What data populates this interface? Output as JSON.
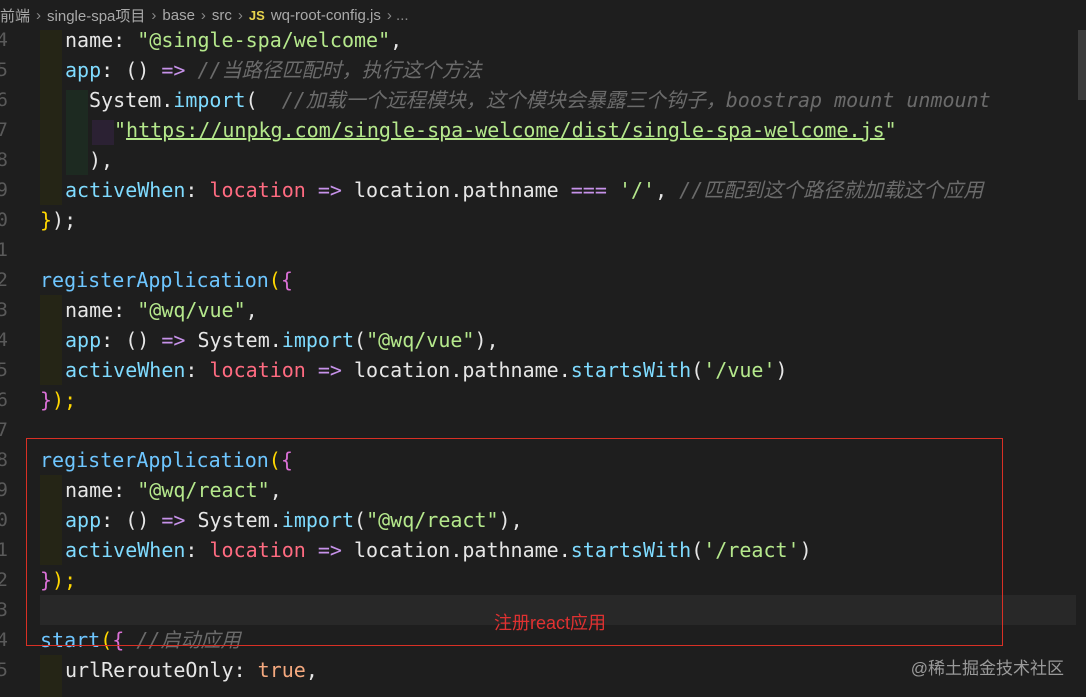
{
  "breadcrumb": {
    "items": [
      "前端",
      "single-spa项目",
      "base",
      "src"
    ],
    "separator": "›",
    "file_badge": "JS",
    "file": "wq-root-config.js",
    "trailing": "› ..."
  },
  "editor": {
    "line_numbers": [
      "4",
      "5",
      "6",
      "7",
      "8",
      "9",
      "0",
      "1",
      "2",
      "3",
      "4",
      "5",
      "6",
      "7",
      "8",
      "9",
      "0",
      "1",
      "2",
      "3",
      "4",
      "5"
    ],
    "lines": {
      "l1": {
        "k": "name",
        "colon": ": ",
        "v": "\"@single-spa/welcome\"",
        "end": ","
      },
      "l2": {
        "k": "app",
        "colon": ": ",
        "a": "() ",
        "arrow": "=>",
        "sp": " ",
        "c": "//当路径匹配时，执行这个方法"
      },
      "l3": {
        "obj": "System",
        "dot": ".",
        "fn": "import",
        "p": "(",
        "sp": "  ",
        "c": "//加载一个远程模块，这个模块会暴露三个钩子，boostrap mount unmount"
      },
      "l4": {
        "q1": "\"",
        "url": "https://unpkg.com/single-spa-welcome/dist/single-spa-welcome.js",
        "q2": "\""
      },
      "l5": {
        "t": "),"
      },
      "l6": {
        "k": "activeWhen",
        "colon": ": ",
        "param": "location",
        "arrow": " => ",
        "obj": "location.pathname",
        "eq": " === ",
        "v": "'/'",
        "sp": ", ",
        "c": "//匹配到这个路径就加载这个应用"
      },
      "l7": {
        "b": "}",
        "t": ");"
      },
      "l9": {
        "fn": "registerApplication",
        "p": "(",
        "b": "{"
      },
      "l10": {
        "k": "name",
        "colon": ": ",
        "v": "\"@wq/vue\"",
        "end": ","
      },
      "l11": {
        "k": "app",
        "colon": ": ",
        "a": "() ",
        "arrow": "=>",
        "sp": " ",
        "obj": "System",
        "dot": ".",
        "fn": "import",
        "p": "(",
        "v": "\"@wq/vue\"",
        "end": "),"
      },
      "l12": {
        "k": "activeWhen",
        "colon": ": ",
        "param": "location",
        "arrow": " => ",
        "obj": "location.pathname.",
        "fn": "startsWith",
        "p": "(",
        "v": "'/vue'",
        "end": ")"
      },
      "l13": {
        "b": "}",
        "t": ");"
      },
      "l15": {
        "fn": "registerApplication",
        "p": "(",
        "b": "{"
      },
      "l16": {
        "k": "name",
        "colon": ": ",
        "v": "\"@wq/react\"",
        "end": ","
      },
      "l17": {
        "k": "app",
        "colon": ": ",
        "a": "() ",
        "arrow": "=>",
        "sp": " ",
        "obj": "System",
        "dot": ".",
        "fn": "import",
        "p": "(",
        "v": "\"@wq/react\"",
        "end": "),"
      },
      "l18": {
        "k": "activeWhen",
        "colon": ": ",
        "param": "location",
        "arrow": " => ",
        "obj": "location.pathname.",
        "fn": "startsWith",
        "p": "(",
        "v": "'/react'",
        "end": ")"
      },
      "l19": {
        "b": "}",
        "t": ");"
      },
      "l21": {
        "fn": "start",
        "p": "(",
        "b": "{",
        "sp": " ",
        "c": "//启动应用"
      },
      "l22": {
        "k": "urlRerouteOnly",
        "colon": ": ",
        "v": "true",
        "end": ","
      }
    }
  },
  "annotation": {
    "text": "注册react应用",
    "color": "#e03131"
  },
  "watermark": {
    "text": "@稀土掘金技术社区"
  }
}
